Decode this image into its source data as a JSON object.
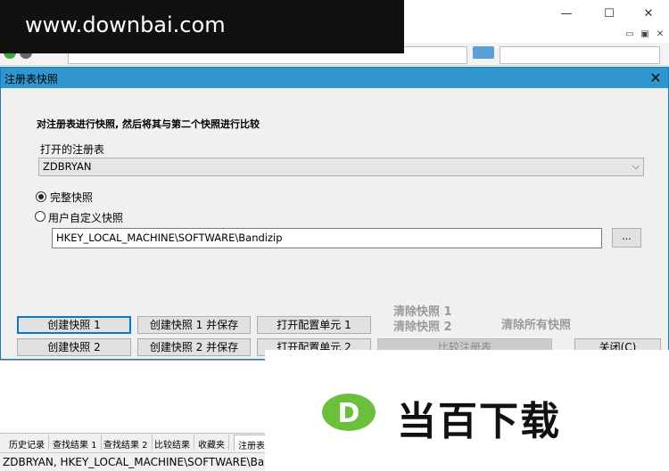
{
  "main_window": {
    "controls": {
      "minimize": "—",
      "maximize": "☐",
      "close": "✕"
    },
    "mdi_controls": {
      "minimize": "▭",
      "restore": "▣",
      "close": "✕"
    }
  },
  "watermark_top": {
    "text": "www.downbai.com"
  },
  "dialog": {
    "title": "注册表快照",
    "close": "✕",
    "instruction": "对注册表进行快照, 然后将其与第二个快照进行比较",
    "hive_label": "打开的注册表",
    "hive_value": "ZDBRYAN",
    "options": [
      {
        "label": "完整快照",
        "selected": true
      },
      {
        "label": "用户自定义快照",
        "selected": false
      }
    ],
    "key_path": "HKEY_LOCAL_MACHINE\\SOFTWARE\\Bandizip",
    "browse_label": "...",
    "buttons": {
      "create1": "创建快照 1",
      "create1_save": "创建快照 1 并保存",
      "open_hive1": "打开配置单元 1",
      "create2": "创建快照 2",
      "create2_save": "创建快照 2 并保存",
      "open_hive2": "打开配置单元 2",
      "compare": "比较注册表",
      "close": "关闭(C)"
    },
    "clear1": "清除快照 1",
    "clear2": "清除快照 2",
    "clear_all": "清除所有快照"
  },
  "tabs": [
    "历史记录",
    "查找结果 1",
    "查找结果 2",
    "比较结果",
    "收藏夹",
    "注册表"
  ],
  "status_text": "ZDBRYAN, HKEY_LOCAL_MACHINE\\SOFTWARE\\Bandizip",
  "watermark_bottom": {
    "logo_letter": "D",
    "brand": "当百下载",
    "logo_color": "#6cbf3c"
  }
}
